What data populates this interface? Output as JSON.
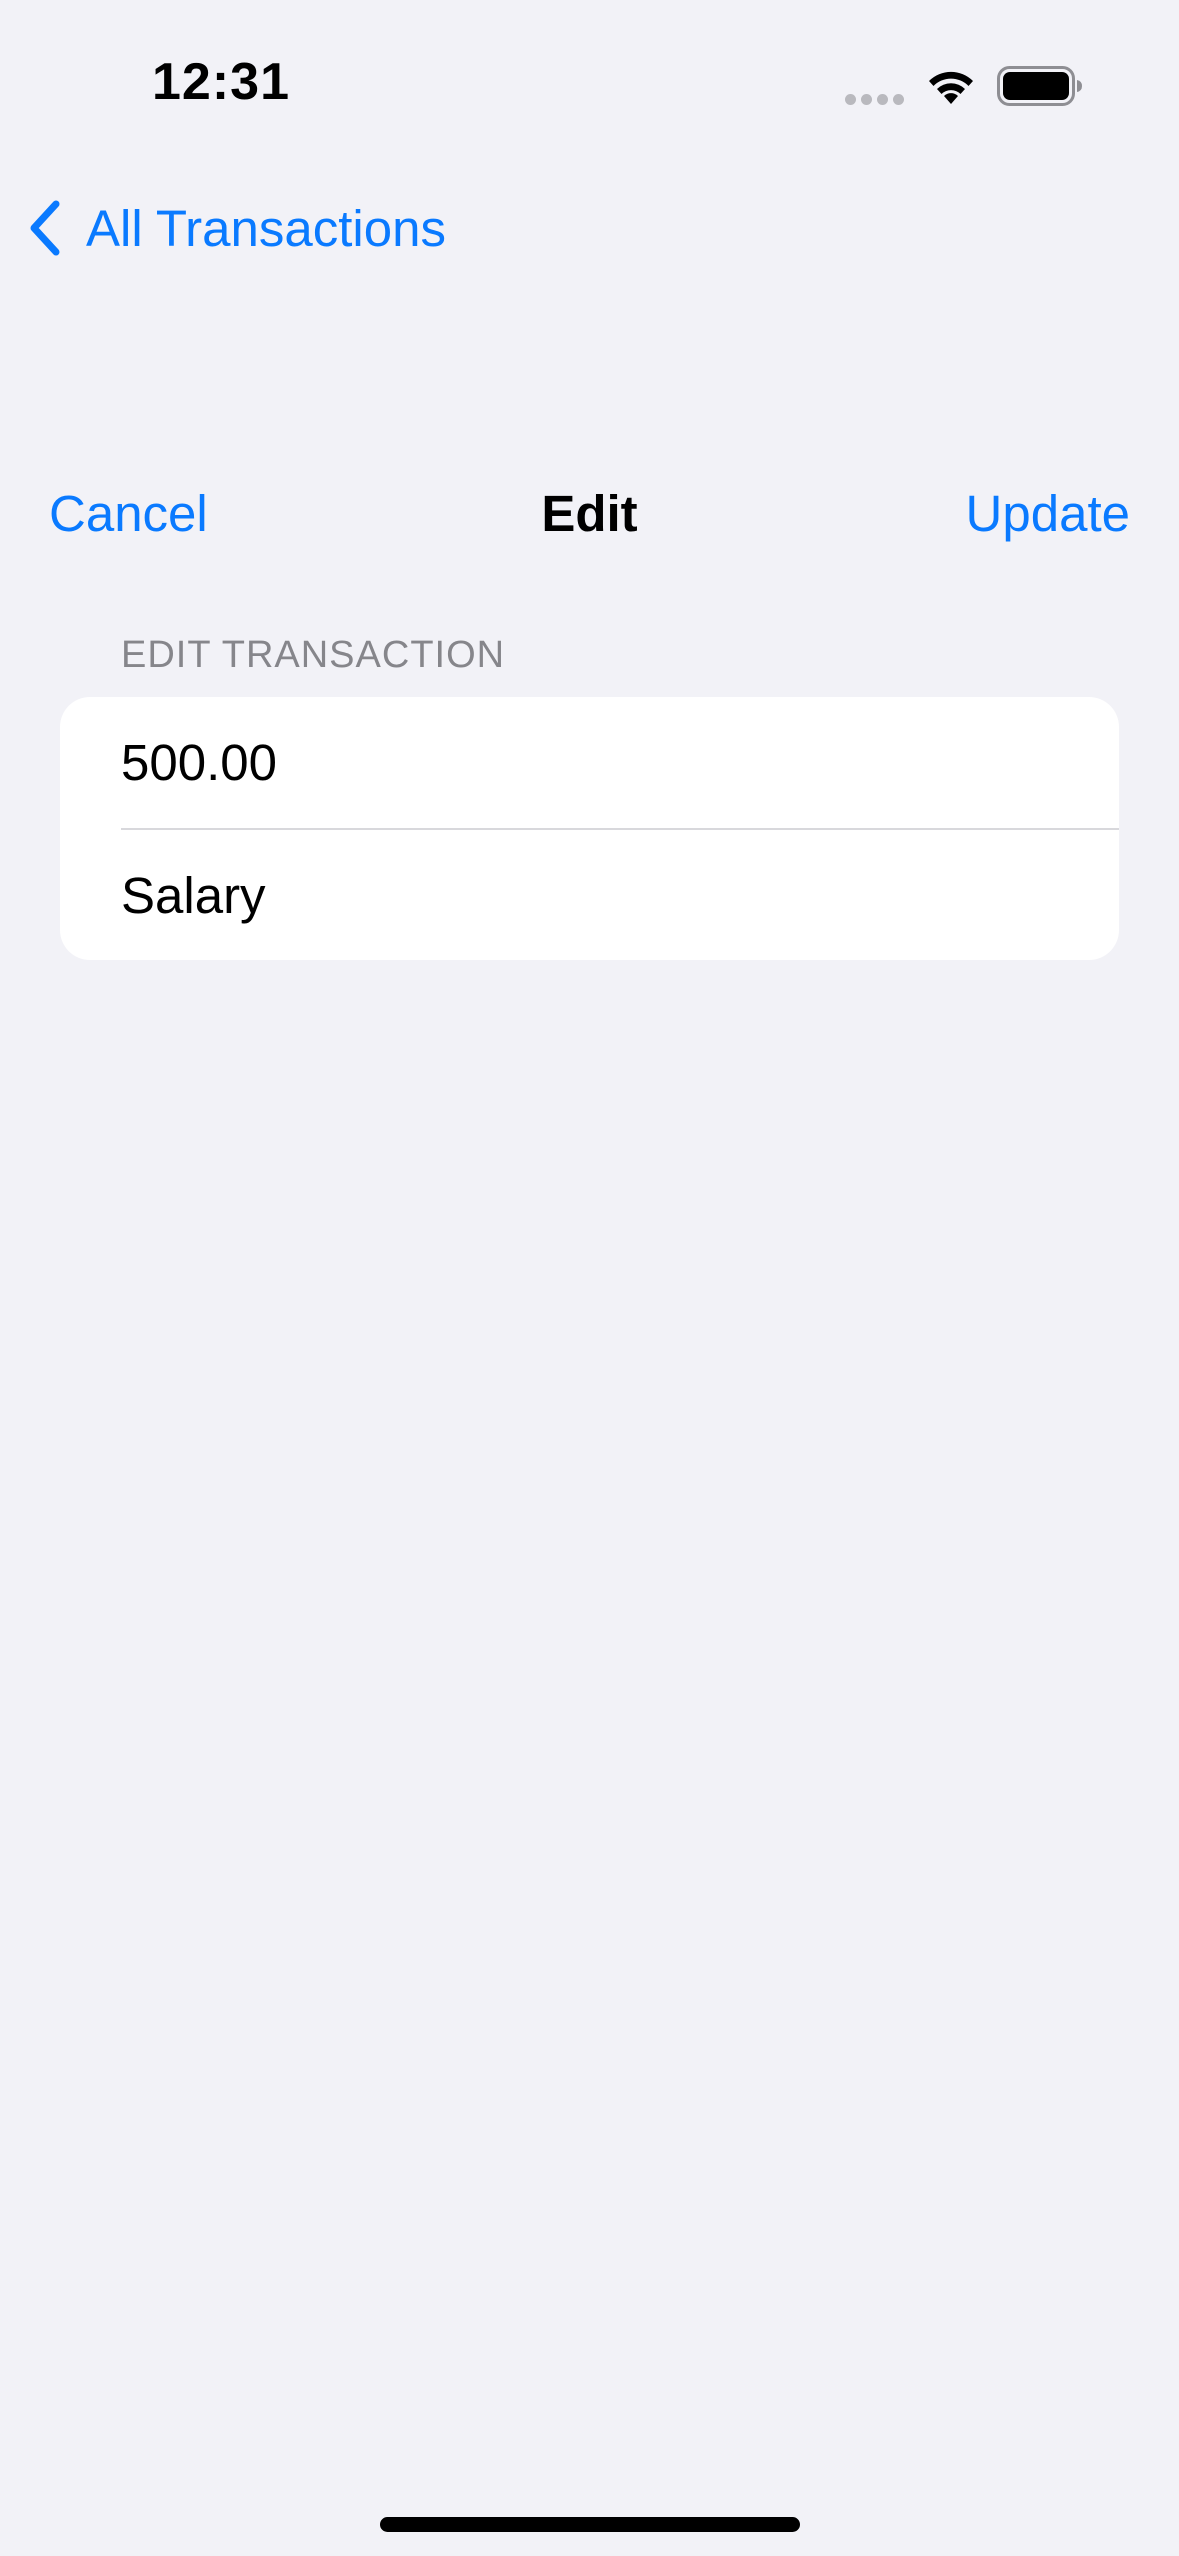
{
  "status_bar": {
    "time": "12:31",
    "icons": [
      "cell-signal-icon",
      "wifi-icon",
      "battery-icon"
    ]
  },
  "navigation": {
    "back_label": "All Transactions",
    "back_icon": "chevron-left-icon"
  },
  "sheet": {
    "cancel_label": "Cancel",
    "title": "Edit",
    "update_label": "Update"
  },
  "form": {
    "section_header": "EDIT TRANSACTION",
    "amount_value": "500.00",
    "description_value": "Salary"
  },
  "colors": {
    "accent": "#0A7AFF",
    "background": "#F2F2F7",
    "card": "#FFFFFF",
    "secondary_text": "#86868B"
  }
}
